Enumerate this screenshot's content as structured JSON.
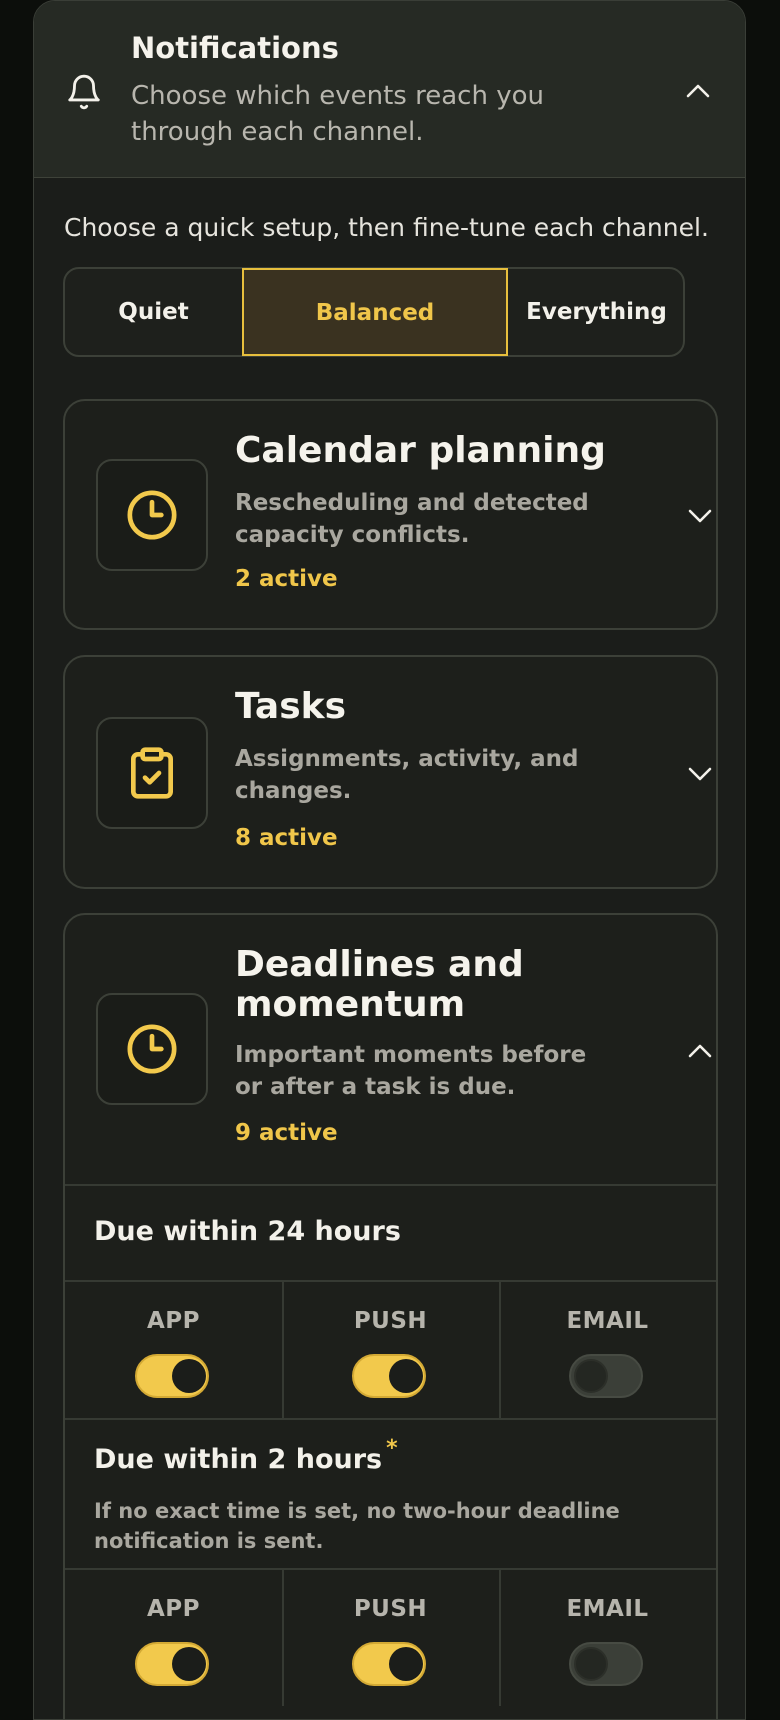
{
  "header": {
    "title": "Notifications",
    "subtitle": "Choose which events reach you through each channel."
  },
  "intro": "Choose a quick setup, then fine-tune each channel.",
  "presets": {
    "options": [
      "Quiet",
      "Balanced",
      "Everything"
    ],
    "selected": "Balanced"
  },
  "categories": [
    {
      "title": "Calendar planning",
      "description": "Rescheduling and detected capacity conflicts.",
      "active": "2 active",
      "icon": "clock-icon",
      "expanded": false
    },
    {
      "title": "Tasks",
      "description": "Assignments, activity, and changes.",
      "active": "8 active",
      "icon": "clipboard-check-icon",
      "expanded": false
    },
    {
      "title": "Deadlines and momentum",
      "description": "Important moments before or after a task is due.",
      "active": "9 active",
      "icon": "clock-icon",
      "expanded": true
    }
  ],
  "deadlines": {
    "items": [
      {
        "title": "Due within 24 hours",
        "required_mark": "",
        "note": "",
        "channels": {
          "app": true,
          "push": true,
          "email": false
        }
      },
      {
        "title": "Due within 2 hours",
        "required_mark": "*",
        "note": "If no exact time is set, no two-hour deadline notification is sent.",
        "channels": {
          "app": true,
          "push": true,
          "email": false
        }
      }
    ]
  },
  "channel_labels": {
    "app": "APP",
    "push": "PUSH",
    "email": "EMAIL"
  },
  "colors": {
    "accent": "#f0c64a",
    "background": "#1b1d1a"
  }
}
